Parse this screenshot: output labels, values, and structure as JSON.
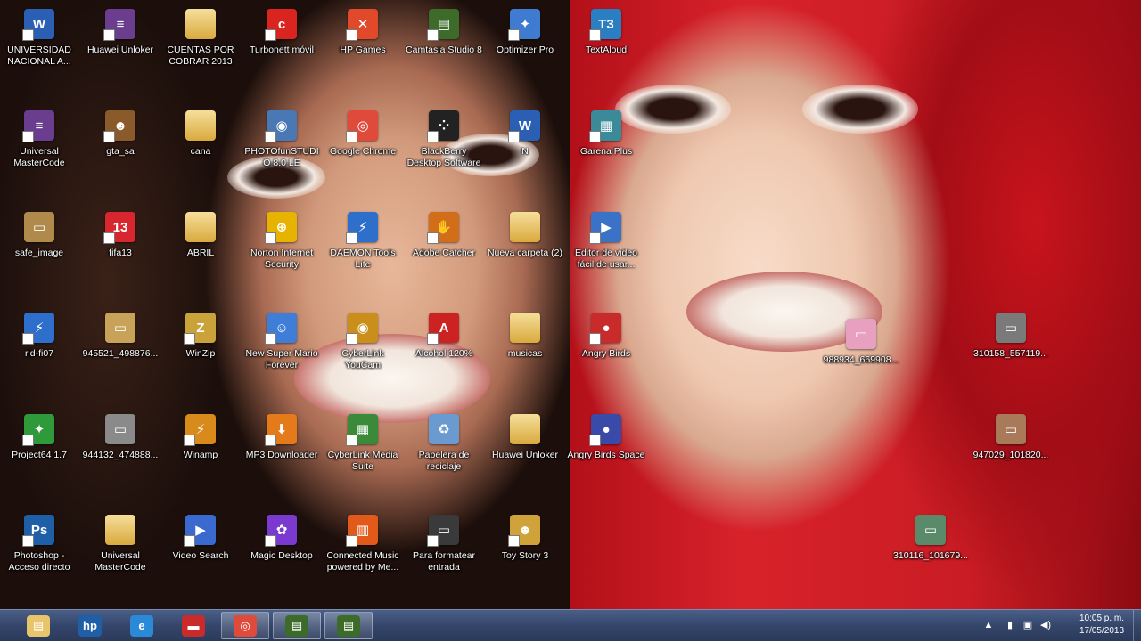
{
  "desktop_icons": [
    {
      "label": "UNIVERSIDAD NACIONAL A...",
      "icon": "word-document-icon",
      "color": "#2b5fb4",
      "text": "W"
    },
    {
      "label": "Huawei Unloker",
      "icon": "winrar-icon",
      "color": "#6a3d8f",
      "text": "≡"
    },
    {
      "label": "CUENTAS POR COBRAR 2013",
      "icon": "folder-icon",
      "color": "#e8c46a",
      "text": ""
    },
    {
      "label": "Turbonett móvil",
      "icon": "claro-icon",
      "color": "#d9241f",
      "text": "c"
    },
    {
      "label": "HP Games",
      "icon": "hp-games-icon",
      "color": "#e0492a",
      "text": "✕"
    },
    {
      "label": "Camtasia Studio 8",
      "icon": "camtasia-icon",
      "color": "#3c6b2a",
      "text": "▤"
    },
    {
      "label": "Optimizer Pro",
      "icon": "optimizer-icon",
      "color": "#3f7bd1",
      "text": "✦"
    },
    {
      "label": "TextAloud",
      "icon": "textaloud-icon",
      "color": "#2a7fc2",
      "text": "T3"
    },
    {
      "label": "Universal MasterCode",
      "icon": "winrar-icon",
      "color": "#6a3d8f",
      "text": "≡"
    },
    {
      "label": "gta_sa",
      "icon": "gta-icon",
      "color": "#8b5a2b",
      "text": "☻"
    },
    {
      "label": "cana",
      "icon": "folder-icon",
      "color": "#e8c46a",
      "text": ""
    },
    {
      "label": "PHOTOfunSTUDIO 8.0 LE",
      "icon": "camera-icon",
      "color": "#4a78b5",
      "text": "◉"
    },
    {
      "label": "Google Chrome",
      "icon": "chrome-icon",
      "color": "#e04a3a",
      "text": "◎"
    },
    {
      "label": "BlackBerry Desktop Software",
      "icon": "blackberry-icon",
      "color": "#222222",
      "text": "⁘"
    },
    {
      "label": "N",
      "icon": "word-document-icon",
      "color": "#2b5fb4",
      "text": "W"
    },
    {
      "label": "Garena Plus",
      "icon": "garena-icon",
      "color": "#3a8a9a",
      "text": "▦"
    },
    {
      "label": "safe_image",
      "icon": "image-icon",
      "color": "#b08a4a",
      "text": "▭"
    },
    {
      "label": "fifa13",
      "icon": "fifa-icon",
      "color": "#d7262d",
      "text": "13"
    },
    {
      "label": "ABRIL",
      "icon": "folder-icon",
      "color": "#e8c46a",
      "text": ""
    },
    {
      "label": "Norton Internet Security",
      "icon": "norton-icon",
      "color": "#e5b300",
      "text": "⊕"
    },
    {
      "label": "DAEMON Tools Lite",
      "icon": "daemon-icon",
      "color": "#2f6fcc",
      "text": "⚡"
    },
    {
      "label": "Adobe Catcher",
      "icon": "catcher-icon",
      "color": "#d26d1a",
      "text": "✋"
    },
    {
      "label": "Nueva carpeta (2)",
      "icon": "folder-icon",
      "color": "#e8c46a",
      "text": ""
    },
    {
      "label": "Editor de video fácil de usar...",
      "icon": "video-editor-icon",
      "color": "#3a72c8",
      "text": "▶"
    },
    {
      "label": "rld-fi07",
      "icon": "daemon-icon",
      "color": "#2f6fcc",
      "text": "⚡"
    },
    {
      "label": "945521_498876...",
      "icon": "image-icon",
      "color": "#c9a25a",
      "text": "▭"
    },
    {
      "label": "WinZip",
      "icon": "winzip-icon",
      "color": "#c9a23a",
      "text": "Z"
    },
    {
      "label": "New Super Mario Forever",
      "icon": "mario-icon",
      "color": "#3e7dd8",
      "text": "☺"
    },
    {
      "label": "CyberLink YouCam",
      "icon": "youcam-icon",
      "color": "#c98f1a",
      "text": "◉"
    },
    {
      "label": "Alcohol 120%",
      "icon": "alcohol-icon",
      "color": "#cc2222",
      "text": "A"
    },
    {
      "label": "musicas",
      "icon": "folder-icon",
      "color": "#e8c46a",
      "text": ""
    },
    {
      "label": "Angry Birds",
      "icon": "angry-birds-icon",
      "color": "#c92a2a",
      "text": "●"
    },
    {
      "label": "Project64 1.7",
      "icon": "project64-icon",
      "color": "#2f9a3a",
      "text": "✦"
    },
    {
      "label": "944132_474888...",
      "icon": "image-icon",
      "color": "#8a8a8a",
      "text": "▭"
    },
    {
      "label": "Winamp",
      "icon": "winamp-icon",
      "color": "#d88a1a",
      "text": "⚡"
    },
    {
      "label": "MP3 Downloader",
      "icon": "mp3-downloader-icon",
      "color": "#e57a1a",
      "text": "⬇"
    },
    {
      "label": "CyberLink Media Suite",
      "icon": "media-suite-icon",
      "color": "#3a8a3a",
      "text": "▦"
    },
    {
      "label": "Papelera de reciclaje",
      "icon": "recycle-bin-icon",
      "color": "#6a9ad0",
      "text": "♻"
    },
    {
      "label": "Huawei Unloker",
      "icon": "folder-icon",
      "color": "#e8c46a",
      "text": ""
    },
    {
      "label": "Angry Birds Space",
      "icon": "angry-birds-space-icon",
      "color": "#3a4aa8",
      "text": "●"
    },
    {
      "label": "Photoshop - Acceso directo",
      "icon": "photoshop-icon",
      "color": "#1f5fa8",
      "text": "Ps"
    },
    {
      "label": "Universal MasterCode",
      "icon": "folder-icon",
      "color": "#e8c46a",
      "text": ""
    },
    {
      "label": "Video Search",
      "icon": "video-search-icon",
      "color": "#3a6ad0",
      "text": "▶"
    },
    {
      "label": "Magic Desktop",
      "icon": "magic-desktop-icon",
      "color": "#7a3ad0",
      "text": "✿"
    },
    {
      "label": "Connected Music powered by Me...",
      "icon": "connected-music-icon",
      "color": "#e25a1a",
      "text": "▥"
    },
    {
      "label": "Para formatear entrada",
      "icon": "usb-drive-icon",
      "color": "#3a3a3a",
      "text": "▭"
    },
    {
      "label": "Toy Story 3",
      "icon": "toy-story-icon",
      "color": "#d0a23a",
      "text": "☻"
    },
    {
      "label": "988934_669908...",
      "icon": "image-icon",
      "color": "#e8a0c0",
      "text": "▭"
    },
    {
      "label": "310158_557119...",
      "icon": "image-icon",
      "color": "#7a7a7a",
      "text": "▭"
    },
    {
      "label": "947029_101820...",
      "icon": "image-icon",
      "color": "#a87a5a",
      "text": "▭"
    },
    {
      "label": "310116_101679...",
      "icon": "image-icon",
      "color": "#5a8a6a",
      "text": "▭"
    }
  ],
  "taskbar": {
    "items": [
      {
        "name": "file-explorer",
        "icon": "folder-icon",
        "color": "#e8c46a",
        "text": "▤",
        "active": false
      },
      {
        "name": "hp",
        "icon": "hp-logo-icon",
        "color": "#1f5fa8",
        "text": "hp",
        "active": false
      },
      {
        "name": "internet-explorer",
        "icon": "internet-explorer-icon",
        "color": "#2a8ad8",
        "text": "e",
        "active": false
      },
      {
        "name": "game",
        "icon": "game-car-icon",
        "color": "#c92a2a",
        "text": "▬",
        "active": false
      },
      {
        "name": "chrome",
        "icon": "chrome-icon",
        "color": "#e04a3a",
        "text": "◎",
        "active": true
      },
      {
        "name": "camtasia-recorder",
        "icon": "camtasia-icon",
        "color": "#3c6b2a",
        "text": "▤",
        "active": true
      },
      {
        "name": "camtasia-studio",
        "icon": "camtasia-recorder-icon",
        "color": "#3c6b2a",
        "text": "▤",
        "active": true
      }
    ],
    "tray": {
      "time": "10:05 p. m.",
      "date": "17/05/2013",
      "icons": [
        "show-hidden-icon",
        "power-icon",
        "network-icon",
        "volume-icon"
      ]
    }
  }
}
